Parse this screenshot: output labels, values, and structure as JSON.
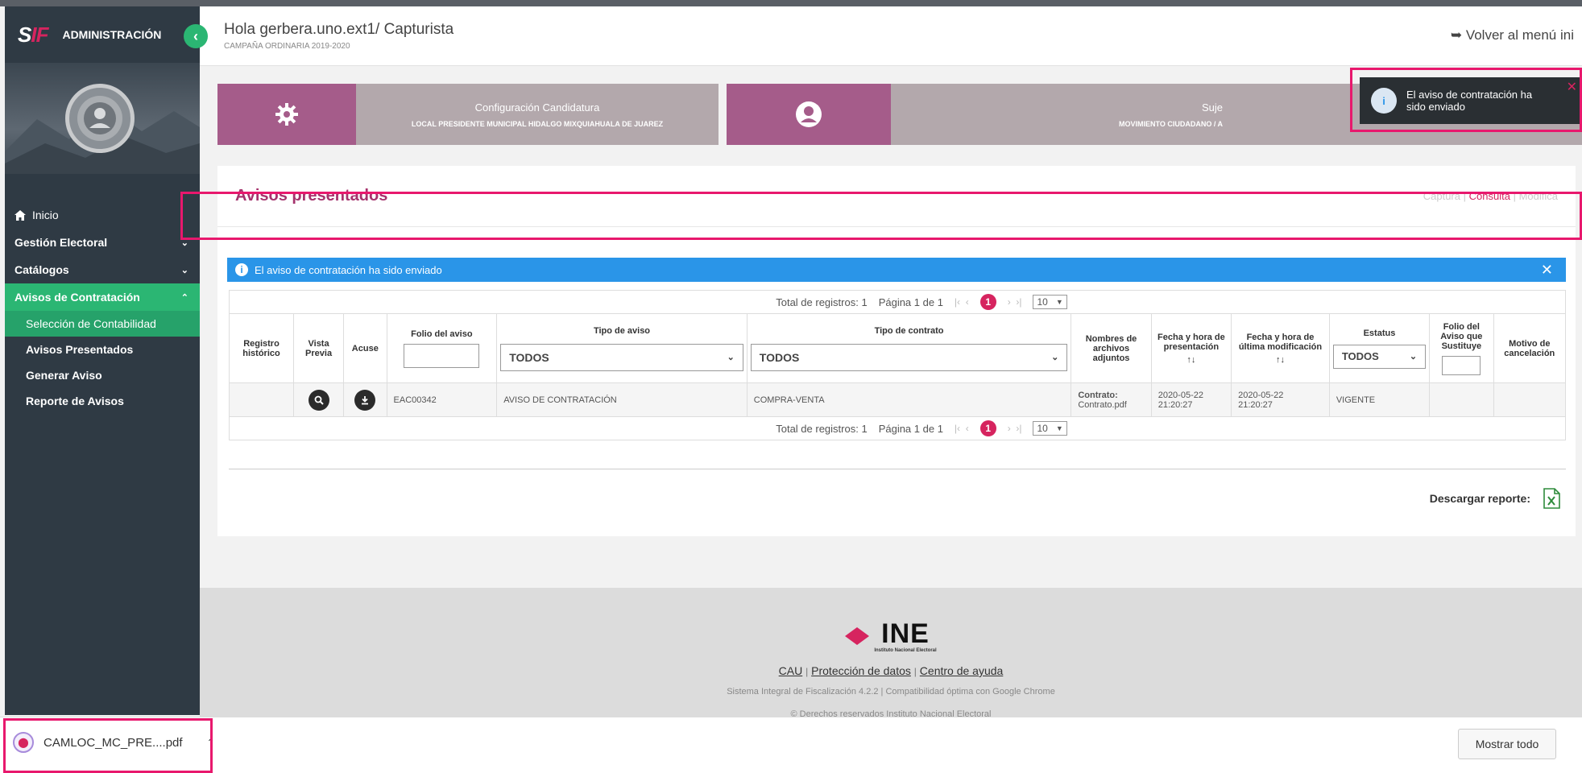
{
  "app": {
    "brand_text": "ADMINISTRACIÓN",
    "brand_logo_a": "S",
    "brand_logo_b": "IF"
  },
  "header": {
    "greeting": "Hola gerbera.uno.ext1/ Capturista",
    "campaign": "CAMPAÑA ORDINARIA 2019-2020",
    "back_label": "Volver al menú ini"
  },
  "sidebar": {
    "items": [
      {
        "label": "Inicio"
      },
      {
        "label": "Gestión Electoral"
      },
      {
        "label": "Catálogos"
      },
      {
        "label": "Avisos de Contratación"
      }
    ],
    "subitems": [
      {
        "label": "Selección de Contabilidad"
      },
      {
        "label": "Avisos Presentados"
      },
      {
        "label": "Generar Aviso"
      },
      {
        "label": "Reporte de Avisos"
      }
    ]
  },
  "cards": {
    "config_title": "Configuración Candidatura",
    "config_detail": "LOCAL PRESIDENTE MUNICIPAL HIDALGO MIXQUIAHUALA DE JUAREZ",
    "subject_title": "Suje",
    "subject_detail": "MOVIMIENTO CIUDADANO / A"
  },
  "panel": {
    "title": "Avisos presentados",
    "modes": [
      "Captura",
      "Consulta",
      "Modifica"
    ],
    "mode_sep": "|",
    "alert_text": "El aviso de contratación ha sido enviado",
    "alert_close": "✕"
  },
  "pager": {
    "total": "Total de registros: 1",
    "page": "Página 1 de 1",
    "current": "1",
    "size": "10"
  },
  "table": {
    "headers": {
      "registro": "Registro histórico",
      "vista": "Vista Previa",
      "acuse": "Acuse",
      "folio": "Folio del aviso",
      "tipo_aviso": "Tipo de aviso",
      "tipo_contrato": "Tipo de contrato",
      "nombres": "Nombres de archivos adjuntos",
      "fecha_pres": "Fecha y hora de presentación",
      "fecha_mod": "Fecha y hora de última modificación",
      "estatus": "Estatus",
      "folio_sust": "Folio del Aviso que Sustituye",
      "motivo": "Motivo de cancelación"
    },
    "filters": {
      "tipo_aviso": "TODOS",
      "tipo_contrato": "TODOS",
      "estatus": "TODOS"
    },
    "rows": [
      {
        "folio": "EAC00342",
        "tipo_aviso": "AVISO DE CONTRATACIÓN",
        "tipo_contrato": "COMPRA-VENTA",
        "archivo_label": "Contrato:",
        "archivo_name": "Contrato.pdf",
        "fecha_pres_date": "2020-05-22",
        "fecha_pres_time": "21:20:27",
        "fecha_mod_date": "2020-05-22",
        "fecha_mod_time": "21:20:27",
        "estatus": "VIGENTE"
      }
    ]
  },
  "report": {
    "label": "Descargar reporte:"
  },
  "footer": {
    "logo_word": "INE",
    "logo_sub": "Instituto Nacional Electoral",
    "link_cau": "CAU",
    "link_privacy": "Protección de datos",
    "link_help": "Centro de ayuda",
    "system": "Sistema Integral de Fiscalización 4.2.2 | Compatibilidad óptima con Google Chrome",
    "copyright": "© Derechos reservados Instituto Nacional Electoral"
  },
  "toast": {
    "text": "El aviso de contratación ha sido enviado",
    "close": "✕"
  },
  "downloads": {
    "file": "CAMLOC_MC_PRE....pdf",
    "show_all": "Mostrar todo"
  },
  "colors": {
    "accent_pink": "#d6245f",
    "sidebar_bg": "#2f3a44",
    "active_green": "#2bb673",
    "alert_blue": "#2a95e8",
    "card_purple": "#a55c8a"
  }
}
